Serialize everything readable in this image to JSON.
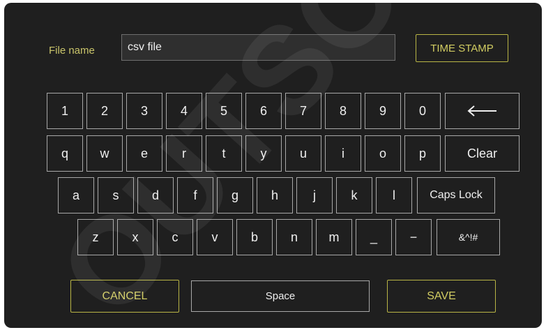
{
  "header": {
    "file_name_label": "File name",
    "file_name_value": "csv file",
    "time_stamp_button": "TIME STAMP"
  },
  "keyboard": {
    "row1": [
      "1",
      "2",
      "3",
      "4",
      "5",
      "6",
      "7",
      "8",
      "9",
      "0"
    ],
    "backspace_glyph": "⟵",
    "row2": [
      "q",
      "w",
      "e",
      "r",
      "t",
      "y",
      "u",
      "i",
      "o",
      "p"
    ],
    "clear_label": "Clear",
    "row3": [
      "a",
      "s",
      "d",
      "f",
      "g",
      "h",
      "j",
      "k",
      "l"
    ],
    "caps_lock_label": "Caps Lock",
    "row4": [
      "z",
      "x",
      "c",
      "v",
      "b",
      "n",
      "m",
      "_",
      "−"
    ],
    "symbols_label": "&^!#"
  },
  "footer": {
    "cancel_label": "CANCEL",
    "space_label": "Space",
    "save_label": "SAVE"
  },
  "watermark": {
    "text": "OUTSCHE"
  },
  "colors": {
    "panel_background": "#1f1f1f",
    "accent": "#c9c46a",
    "key_border": "#a8a8a8",
    "key_text": "#efefef"
  }
}
